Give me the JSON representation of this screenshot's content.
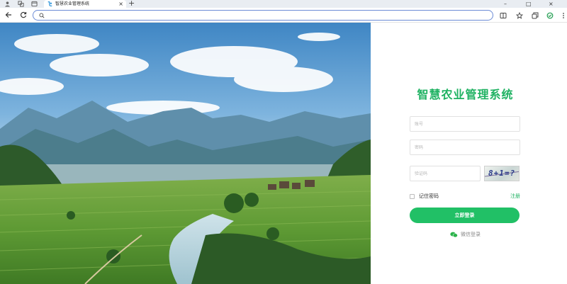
{
  "browser": {
    "tab_title": "智慧农业管理系统",
    "address_placeholder": "",
    "address_value": ""
  },
  "login": {
    "system_title": "智慧农业管理系统",
    "account_placeholder": "账号",
    "password_placeholder": "密码",
    "captcha_placeholder": "验证码",
    "captcha_text": "8+1=?",
    "remember_label": "记住密码",
    "register_label": "注册",
    "login_button": "立即登录",
    "wechat_label": "微信登录"
  },
  "colors": {
    "brand_green": "#1fb262",
    "button_green": "#21c066"
  },
  "icons": [
    "profile-icon",
    "extensions-icon",
    "tab-actions-icon",
    "refresh-icon",
    "back-icon",
    "search-icon",
    "split-view-icon",
    "favorite-icon",
    "collections-icon",
    "browser-essentials-icon",
    "more-icon",
    "wechat-icon"
  ]
}
